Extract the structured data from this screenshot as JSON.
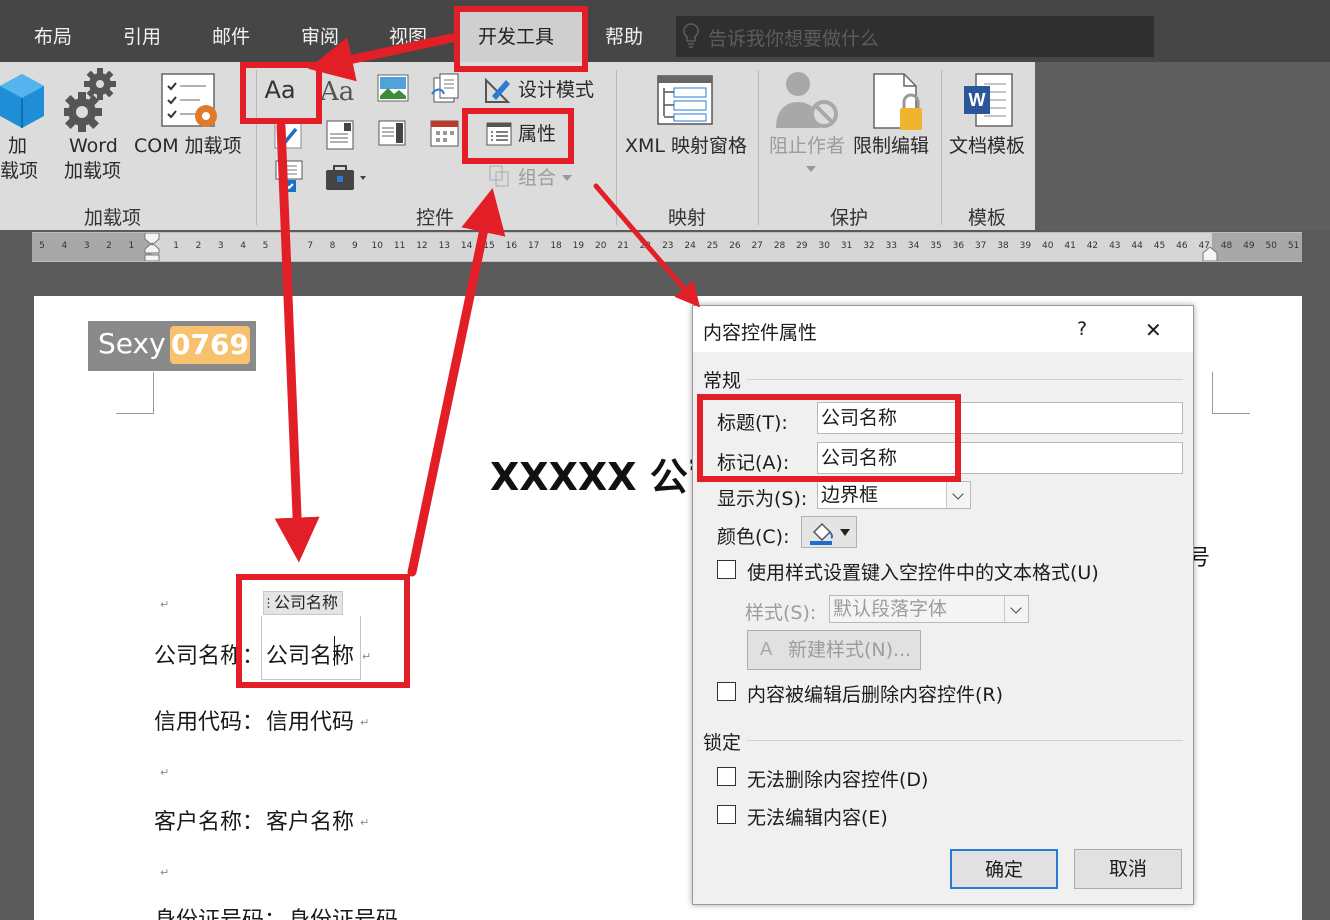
{
  "tabs": [
    "布局",
    "引用",
    "邮件",
    "审阅",
    "视图",
    "开发工具",
    "帮助"
  ],
  "active_tab": "开发工具",
  "tell_me_placeholder": "告诉我你想要做什么",
  "ribbon": {
    "addins": {
      "addin_label_line1": "加",
      "addin_label_line2": "载项",
      "word_addin_line1": "Word",
      "word_addin_line2": "加载项",
      "com_addin": "COM 加载项",
      "group": "加载项"
    },
    "controls": {
      "design_mode": "设计模式",
      "properties": "属性",
      "group_cmd": "组合",
      "group": "控件"
    },
    "mapping": {
      "xml_pane": "XML 映射窗格",
      "group": "映射"
    },
    "protect": {
      "block_authors": "阻止作者",
      "restrict_editing": "限制编辑",
      "group": "保护"
    },
    "templates": {
      "doc_template": "文档模板",
      "group": "模板"
    }
  },
  "ruler_numbers": [
    "5",
    "4",
    "3",
    "2",
    "1",
    "",
    "1",
    "2",
    "3",
    "4",
    "5",
    "",
    "7",
    "8",
    "9",
    "10",
    "11",
    "12",
    "13",
    "14",
    "15",
    "16",
    "17",
    "18",
    "19",
    "20",
    "21",
    "22",
    "23",
    "24",
    "25",
    "26",
    "27",
    "28",
    "29",
    "30",
    "31",
    "32",
    "33",
    "34",
    "35",
    "36",
    "37",
    "38",
    "39",
    "40",
    "41",
    "42",
    "43",
    "44",
    "45",
    "46",
    "47",
    "48",
    "49",
    "50",
    "51"
  ],
  "watermark": {
    "text1": "Sexy",
    "text2": "0769"
  },
  "document": {
    "title": "XXXXX 公司",
    "right_fragment": "号",
    "content_control_tag": "公司名称",
    "content_control_value": "公司名称",
    "rows": [
      {
        "label": "公司名称：",
        "value": ""
      },
      {
        "label": "信用代码：",
        "value": "信用代码"
      },
      {
        "label": "客户名称：",
        "value": "客户名称"
      },
      {
        "label": "身份证号码：",
        "value": "身份证号码"
      }
    ]
  },
  "dialog": {
    "title": "内容控件属性",
    "help": "?",
    "close": "✕",
    "section_general": "常规",
    "title_label": "标题(T):",
    "title_value": "公司名称",
    "tag_label": "标记(A):",
    "tag_value": "公司名称",
    "show_as_label": "显示为(S):",
    "show_as_value": "边界框",
    "color_label": "颜色(C):",
    "use_style_check": "使用样式设置键入空控件中的文本格式(U)",
    "style_label": "样式(S):",
    "style_value": "默认段落字体",
    "new_style_button": "新建样式(N)...",
    "remove_when_edited": "内容被编辑后删除内容控件(R)",
    "section_lock": "锁定",
    "cannot_delete": "无法删除内容控件(D)",
    "cannot_edit": "无法编辑内容(E)",
    "ok": "确定",
    "cancel": "取消"
  },
  "colors": {
    "annotation_red": "#e21f26",
    "ribbon_bg": "#dcdcdc",
    "tabbar_bg": "#464646",
    "word_blue": "#2b579a"
  }
}
